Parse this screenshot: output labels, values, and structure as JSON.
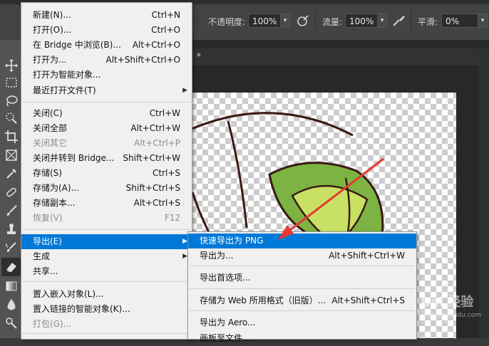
{
  "options_bar": {
    "opacity_label": "不透明度:",
    "opacity_value": "100%",
    "flow_label": "流量:",
    "flow_value": "100%",
    "smooth_label": "平滑:",
    "smooth_value": "0%"
  },
  "document": {
    "tab_marker": "*"
  },
  "file_menu": {
    "items": [
      {
        "label": "新建(N)...",
        "shortcut": "Ctrl+N",
        "disabled": false
      },
      {
        "label": "打开(O)...",
        "shortcut": "Ctrl+O",
        "disabled": false
      },
      {
        "label": "在 Bridge 中浏览(B)...",
        "shortcut": "Alt+Ctrl+O",
        "disabled": false
      },
      {
        "label": "打开为...",
        "shortcut": "Alt+Shift+Ctrl+O",
        "disabled": false
      },
      {
        "label": "打开为智能对象...",
        "shortcut": "",
        "disabled": false
      },
      {
        "label": "最近打开文件(T)",
        "shortcut": "",
        "disabled": false,
        "submenu": true
      },
      {
        "label": "关闭(C)",
        "shortcut": "Ctrl+W",
        "disabled": false
      },
      {
        "label": "关闭全部",
        "shortcut": "Alt+Ctrl+W",
        "disabled": false
      },
      {
        "label": "关闭其它",
        "shortcut": "Alt+Ctrl+P",
        "disabled": true
      },
      {
        "label": "关闭并转到 Bridge...",
        "shortcut": "Shift+Ctrl+W",
        "disabled": false
      },
      {
        "label": "存储(S)",
        "shortcut": "Ctrl+S",
        "disabled": false
      },
      {
        "label": "存储为(A)...",
        "shortcut": "Shift+Ctrl+S",
        "disabled": false
      },
      {
        "label": "存储副本...",
        "shortcut": "Alt+Ctrl+S",
        "disabled": false
      },
      {
        "label": "恢复(V)",
        "shortcut": "F12",
        "disabled": true
      },
      {
        "label": "导出(E)",
        "shortcut": "",
        "disabled": false,
        "submenu": true,
        "highlighted": true
      },
      {
        "label": "生成",
        "shortcut": "",
        "disabled": false,
        "submenu": true
      },
      {
        "label": "共享...",
        "shortcut": "",
        "disabled": false
      },
      {
        "label": "置入嵌入对象(L)...",
        "shortcut": "",
        "disabled": false
      },
      {
        "label": "置入链接的智能对象(K)...",
        "shortcut": "",
        "disabled": false
      },
      {
        "label": "打包(G)...",
        "shortcut": "",
        "disabled": true
      }
    ]
  },
  "export_submenu": {
    "items": [
      {
        "label": "快速导出为 PNG",
        "shortcut": "",
        "highlighted": true
      },
      {
        "label": "导出为...",
        "shortcut": "Alt+Shift+Ctrl+W"
      },
      {
        "label": "导出首选项...",
        "shortcut": ""
      },
      {
        "label": "存储为 Web 所用格式（旧版）...",
        "shortcut": "Alt+Shift+Ctrl+S"
      },
      {
        "label": "导出为 Aero...",
        "shortcut": ""
      },
      {
        "label": "画板至文件...",
        "shortcut": ""
      }
    ]
  },
  "colors": {
    "highlight": "#0078d7",
    "annotation_arrow": "#e53935",
    "leaf_green": "#7cb342"
  },
  "watermark": {
    "text": "Bai 经验",
    "sub": "jingyan.baidu.com"
  }
}
